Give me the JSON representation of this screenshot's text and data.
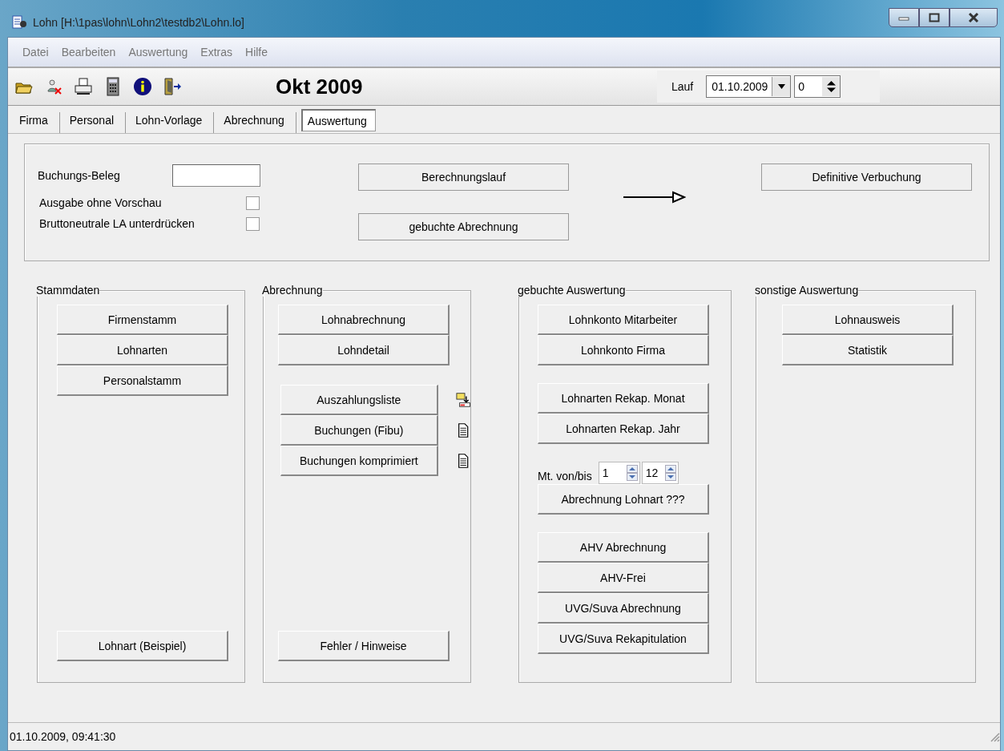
{
  "window": {
    "title": "Lohn [H:\\1pas\\lohn\\Lohn2\\testdb2\\Lohn.lo]"
  },
  "menu": [
    "Datei",
    "Bearbeiten",
    "Auswertung",
    "Extras",
    "Hilfe"
  ],
  "toolbar": {
    "period": "Okt 2009",
    "run": {
      "label": "Lauf",
      "date": "01.10.2009",
      "number": "0"
    }
  },
  "tabs": [
    {
      "label": "Firma",
      "selected": false
    },
    {
      "label": "Personal",
      "selected": false
    },
    {
      "label": "Lohn-Vorlage",
      "selected": false
    },
    {
      "label": "Abrechnung",
      "selected": false
    },
    {
      "label": "Auswertung",
      "selected": true
    }
  ],
  "booking_panel": {
    "beleg_label": "Buchungs-Beleg",
    "checkboxes": [
      {
        "label": "Ausgabe ohne Vorschau",
        "checked": false
      },
      {
        "label": "Bruttoneutrale LA unterdrücken",
        "checked": false
      }
    ],
    "buttons": [
      "Berechnungslauf",
      "gebuchte Abrechnung"
    ],
    "final_button": "Definitive Verbuchung"
  },
  "groups": [
    {
      "title": "Stammdaten",
      "sections": [
        {
          "items": [
            {
              "label": "Firmenstamm"
            },
            {
              "label": "Lohnarten"
            },
            {
              "label": "Personalstamm"
            }
          ]
        }
      ],
      "bottom_button": "Lohnart (Beispiel)"
    },
    {
      "title": "Abrechnung",
      "sections": [
        {
          "items": [
            {
              "label": "Lohnabrechnung"
            },
            {
              "label": "Lohndetail"
            }
          ]
        },
        {
          "items": [
            {
              "label": "Auszahlungsliste",
              "kind": "export"
            },
            {
              "label": "Buchungen (Fibu)",
              "kind": "document"
            },
            {
              "label": "Buchungen komprimiert",
              "kind": "document"
            }
          ]
        }
      ],
      "bottom_button": "Fehler / Hinweise"
    },
    {
      "title": "gebuchte Auswertung",
      "sections": [
        {
          "items": [
            {
              "label": "Lohnkonto Mitarbeiter"
            },
            {
              "label": "Lohnkonto Firma"
            }
          ]
        },
        {
          "items": [
            {
              "label": "Lohnarten Rekap. Monat"
            },
            {
              "label": "Lohnarten Rekap. Jahr"
            }
          ]
        },
        {
          "range": {
            "label": "Mt. von/bis",
            "from": "1",
            "to": "12"
          },
          "items": [
            {
              "label": "Abrechnung Lohnart ???"
            }
          ]
        },
        {
          "items": [
            {
              "label": "AHV Abrechnung"
            },
            {
              "label": "AHV-Frei"
            },
            {
              "label": "UVG/Suva Abrechnung"
            },
            {
              "label": "UVG/Suva Rekapitulation"
            }
          ]
        }
      ]
    },
    {
      "title": "sonstige Auswertung",
      "sections": [
        {
          "items": [
            {
              "label": "Lohnausweis"
            },
            {
              "label": "Statistik"
            }
          ]
        }
      ]
    }
  ],
  "status_bar": "01.10.2009, 09:41:30"
}
